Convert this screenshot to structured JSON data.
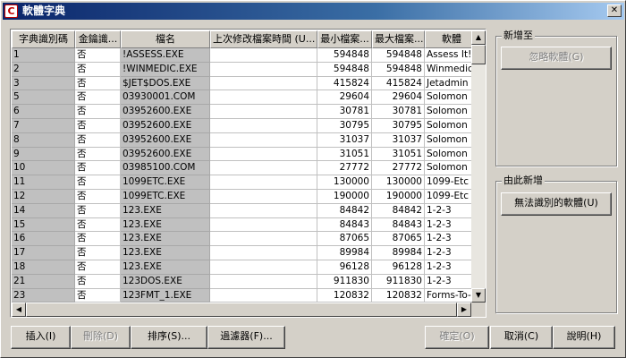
{
  "window": {
    "title": "軟體字典",
    "app_icon_glyph": "C",
    "close_glyph": "✕"
  },
  "columns": [
    "字典識別碼",
    "金鑰識...",
    "檔名",
    "上次修改檔案時間 (U...",
    "最小檔案...",
    "最大檔案...",
    "軟體"
  ],
  "rows": [
    [
      "1",
      "否",
      "!ASSESS.EXE",
      "",
      "594848",
      "594848",
      "Assess It!"
    ],
    [
      "2",
      "否",
      "!WINMEDIC.EXE",
      "",
      "594848",
      "594848",
      "Winmedic!"
    ],
    [
      "3",
      "否",
      "$JET$DOS.EXE",
      "",
      "415824",
      "415824",
      "Jetadmin"
    ],
    [
      "5",
      "否",
      "03930001.COM",
      "",
      "29604",
      "29604",
      "Solomon"
    ],
    [
      "6",
      "否",
      "03952600.EXE",
      "",
      "30781",
      "30781",
      "Solomon"
    ],
    [
      "7",
      "否",
      "03952600.EXE",
      "",
      "30795",
      "30795",
      "Solomon"
    ],
    [
      "8",
      "否",
      "03952600.EXE",
      "",
      "31037",
      "31037",
      "Solomon"
    ],
    [
      "9",
      "否",
      "03952600.EXE",
      "",
      "31051",
      "31051",
      "Solomon"
    ],
    [
      "10",
      "否",
      "03985100.COM",
      "",
      "27772",
      "27772",
      "Solomon"
    ],
    [
      "11",
      "否",
      "1099ETC.EXE",
      "",
      "130000",
      "130000",
      "1099-Etc"
    ],
    [
      "12",
      "否",
      "1099ETC.EXE",
      "",
      "190000",
      "190000",
      "1099-Etc"
    ],
    [
      "14",
      "否",
      "123.EXE",
      "",
      "84842",
      "84842",
      "1-2-3"
    ],
    [
      "15",
      "否",
      "123.EXE",
      "",
      "84843",
      "84843",
      "1-2-3"
    ],
    [
      "16",
      "否",
      "123.EXE",
      "",
      "87065",
      "87065",
      "1-2-3"
    ],
    [
      "17",
      "否",
      "123.EXE",
      "",
      "89984",
      "89984",
      "1-2-3"
    ],
    [
      "18",
      "否",
      "123.EXE",
      "",
      "96128",
      "96128",
      "1-2-3"
    ],
    [
      "21",
      "否",
      "123DOS.EXE",
      "",
      "911830",
      "911830",
      "1-2-3"
    ],
    [
      "23",
      "否",
      "123FMT_1.EXE",
      "",
      "120832",
      "120832",
      "Forms-To-Go"
    ]
  ],
  "add_to_group": {
    "label": "新增至",
    "ignore_button": "忽略軟體(G)"
  },
  "add_from_group": {
    "label": "由此新增",
    "unrecognized_button": "無法識別的軟體(U)"
  },
  "buttons": {
    "insert": "插入(I)",
    "delete": "刪除(D)",
    "sort": "排序(S)...",
    "filter": "過濾器(F)...",
    "ok": "確定(O)",
    "cancel": "取消(C)",
    "help": "說明(H)"
  },
  "scroll": {
    "up": "▲",
    "down": "▼",
    "left": "◀",
    "right": "▶"
  }
}
